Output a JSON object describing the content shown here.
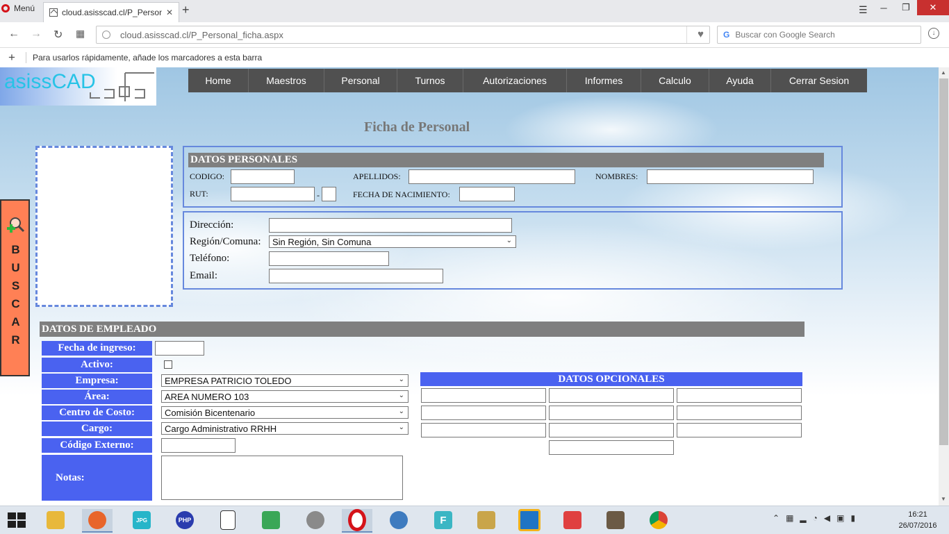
{
  "browser": {
    "menu_label": "Menú",
    "tab_title": "cloud.asisscad.cl/P_Person",
    "url": "cloud.asisscad.cl/P_Personal_ficha.aspx",
    "search_placeholder": "Buscar con Google Search",
    "bookmarks_hint": "Para usarlos rápidamente, añade los marcadores a esta barra"
  },
  "site": {
    "logo_text": "asissCAD",
    "nav": [
      "Home",
      "Maestros",
      "Personal",
      "Turnos",
      "Autorizaciones",
      "Informes",
      "Calculo",
      "Ayuda",
      "Cerrar Sesion"
    ]
  },
  "page_title": "Ficha de Personal",
  "buscar_letters": [
    "B",
    "U",
    "S",
    "C",
    "A",
    "R"
  ],
  "datos_personales": {
    "header": "DATOS PERSONALES",
    "codigo_label": "CODIGO:",
    "apellidos_label": "APELLIDOS:",
    "nombres_label": "NOMBRES:",
    "rut_label": "RUT:",
    "rut_dash": "-",
    "fecha_nac_label": "FECHA DE NACIMIENTO:",
    "direccion_label": "Dirección:",
    "region_label": "Región/Comuna:",
    "region_value": "Sin Región, Sin Comuna",
    "telefono_label": "Teléfono:",
    "email_label": "Email:"
  },
  "datos_empleado": {
    "header": "DATOS DE EMPLEADO",
    "fecha_ingreso_label": "Fecha de ingreso:",
    "activo_label": "Activo:",
    "empresa_label": "Empresa:",
    "empresa_value": "EMPRESA PATRICIO TOLEDO",
    "area_label": "Área:",
    "area_value": "AREA NUMERO 103",
    "centro_label": "Centro de Costo:",
    "centro_value": "Comisión Bicentenario",
    "cargo_label": "Cargo:",
    "cargo_value": "Cargo Administrativo RRHH",
    "codigo_ext_label": "Código Externo:",
    "notas_label": "Notas:"
  },
  "datos_opcionales": {
    "header": "DATOS OPCIONALES"
  },
  "taskbar": {
    "apps": [
      "file-explorer",
      "firefox",
      "jpg-viewer",
      "php",
      "notepad",
      "sync-app",
      "torrent-app",
      "opera",
      "thunderbird",
      "f-app",
      "tools-app",
      "virtualbox",
      "link-app",
      "game-app",
      "chrome"
    ],
    "time": "16:21",
    "date": "26/07/2016"
  },
  "colors": {
    "nav_bg": "#505050",
    "section_header": "#7f7f7f",
    "label_blue": "#4a62f0",
    "buscar_bg": "#ff8055",
    "fieldset_border": "#6688dd"
  }
}
